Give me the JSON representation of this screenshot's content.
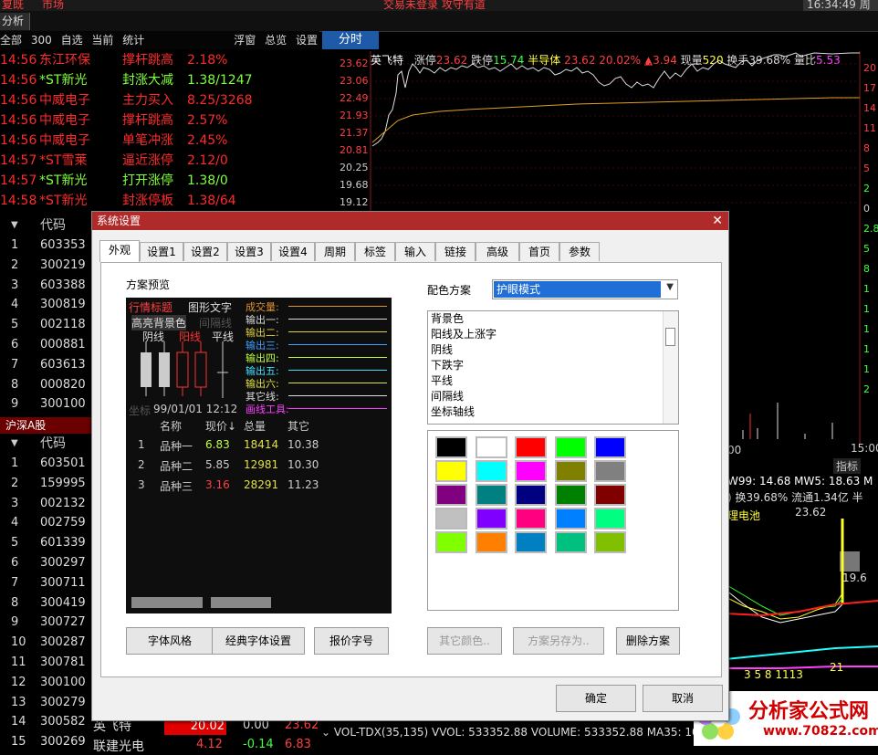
{
  "top": {
    "title_left_1": "复既",
    "title_left_2": "市场",
    "title_center": "交易未登录  攻守有道",
    "title_right": "16:34:49 周六"
  },
  "tabs": {
    "analysis": "分析"
  },
  "filters": {
    "items": [
      "全部",
      "300",
      "自选",
      "当前",
      "统计"
    ],
    "right": [
      "浮窗",
      "总览",
      "设置"
    ]
  },
  "timeshare_tab": "分时",
  "alerts": [
    {
      "time": "14:56",
      "name": "东江环保",
      "event": "撑杆跳高",
      "value": "2.18%",
      "color": "#ff2a2a"
    },
    {
      "time": "14:56",
      "name": "*ST新光",
      "event": "封涨大减",
      "value": "1.38/1247",
      "color": "#7fff3a"
    },
    {
      "time": "14:56",
      "name": "中威电子",
      "event": "主力买入",
      "value": "8.25/3268",
      "color": "#ff2a2a"
    },
    {
      "time": "14:56",
      "name": "中威电子",
      "event": "撑杆跳高",
      "value": "2.57%",
      "color": "#ff2a2a"
    },
    {
      "time": "14:56",
      "name": "中威电子",
      "event": "单笔冲涨",
      "value": "2.45%",
      "color": "#ff2a2a"
    },
    {
      "time": "14:57",
      "name": "*ST雪莱",
      "event": "逼近涨停",
      "value": "2.12/0",
      "color": "#ff2a2a"
    },
    {
      "time": "14:57",
      "name": "*ST新光",
      "event": "打开涨停",
      "value": "1.38/0",
      "color": "#7fff3a"
    },
    {
      "time": "14:58",
      "name": "*ST新光",
      "event": "封涨停板",
      "value": "1.38/64",
      "color": "#ff2a2a"
    }
  ],
  "table1": {
    "header": "代码",
    "rows": [
      {
        "idx": "1",
        "code": "603353"
      },
      {
        "idx": "2",
        "code": "300219"
      },
      {
        "idx": "3",
        "code": "603388"
      },
      {
        "idx": "4",
        "code": "300819"
      },
      {
        "idx": "5",
        "code": "002118"
      },
      {
        "idx": "6",
        "code": "000881"
      },
      {
        "idx": "7",
        "code": "603613"
      },
      {
        "idx": "8",
        "code": "000820"
      },
      {
        "idx": "9",
        "code": "300100"
      }
    ]
  },
  "section2": {
    "title": "沪深A股",
    "header": "代码"
  },
  "table2": {
    "rows": [
      {
        "idx": "1",
        "code": "603501"
      },
      {
        "idx": "2",
        "code": "159995"
      },
      {
        "idx": "3",
        "code": "002132"
      },
      {
        "idx": "4",
        "code": "002759"
      },
      {
        "idx": "5",
        "code": "601339"
      },
      {
        "idx": "6",
        "code": "300297"
      },
      {
        "idx": "7",
        "code": "300711"
      },
      {
        "idx": "8",
        "code": "300419"
      },
      {
        "idx": "9",
        "code": "300727"
      },
      {
        "idx": "10",
        "code": "300287"
      },
      {
        "idx": "11",
        "code": "300781"
      },
      {
        "idx": "12",
        "code": "300100"
      },
      {
        "idx": "13",
        "code": "300279"
      },
      {
        "idx": "14",
        "code": "300582"
      },
      {
        "idx": "15",
        "code": "300269"
      }
    ],
    "row14_name": "英飞特",
    "row14_pct": "20.02",
    "row14_chg": "0.00",
    "row14_price": "23.62",
    "row15_name": "联建光电",
    "row15_pct": "4.12",
    "row15_chg": "-0.14",
    "row15_price": "6.83"
  },
  "chart_header": {
    "name": "英飞特",
    "limit_up_label": "涨停",
    "limit_up": "23.62",
    "limit_down_label": "跌停",
    "limit_down": "15.74",
    "sector": "半导体",
    "price": "23.62",
    "pct": "20.02%",
    "chg": "▲3.94",
    "vol_label": "现量",
    "vol": "520",
    "turnover_label": "换手",
    "turnover": "39.68%",
    "ratio_label": "量比",
    "ratio": "5.53"
  },
  "y_axis": [
    "23.62",
    "23.06",
    "22.49",
    "21.93",
    "21.37",
    "20.81",
    "20.25",
    "19.68",
    "19.12"
  ],
  "right_axis": [
    "20",
    "17",
    "14",
    "11",
    "8",
    "5",
    "2",
    "0",
    "2.8",
    "5",
    "8",
    "1",
    "1",
    "1",
    "1",
    "1",
    "2"
  ],
  "time_end": "15:00",
  "time_mid": "00",
  "kline": {
    "indicator_label": "指标",
    "ma_line": "W99: 14.68  MW5: 18.63  M",
    "info_line": ") 换39.68% 流通1.34亿 半",
    "sector_name": "理电池",
    "high_label": "23.62",
    "side_label": "19.6",
    "low_nums": "3 5  8  1113",
    "low_label": "21"
  },
  "bottom_status": "VOL-TDX(35,135) VVOL: 533352.88 VOLUME: 533352.88 MA35: 108600",
  "watermark": {
    "text": "分析家公式网",
    "url": "www.70822.com"
  },
  "dialog": {
    "title": "系统设置",
    "tabs": [
      "外观",
      "设置1",
      "设置2",
      "设置3",
      "设置4",
      "周期",
      "标签",
      "输入",
      "链接",
      "高级",
      "首页",
      "参数"
    ],
    "preview_label": "方案预览",
    "scheme_label": "配色方案",
    "scheme_value": "护眼模式",
    "color_items": [
      "背景色",
      "阳线及上涨字",
      "阴线",
      "下跌字",
      "平线",
      "间隔线",
      "坐标轴线"
    ],
    "preview": {
      "quote_title": "行情标题",
      "graph_text": "图形文字",
      "hl_bg": "高亮背景色",
      "sep_line": "间隔线",
      "yin": "阴线",
      "yang": "阳线",
      "flat": "平线",
      "outputs": [
        "成交量:",
        "输出一:",
        "输出二:",
        "输出三:",
        "输出四:",
        "输出五:",
        "输出六:",
        "其它线:",
        "画线工具:"
      ],
      "coord_label": "坐标",
      "coord_value": "99/01/01 12:12",
      "cols": [
        "名称",
        "现价↓",
        "总量",
        "其它"
      ],
      "rows": [
        {
          "i": "1",
          "name": "品种一",
          "price": "6.83",
          "vol": "18414",
          "other": "10.38"
        },
        {
          "i": "2",
          "name": "品种二",
          "price": "5.85",
          "vol": "12981",
          "other": "10.30"
        },
        {
          "i": "3",
          "name": "品种三",
          "price": "3.16",
          "vol": "28291",
          "other": "11.23"
        }
      ]
    },
    "buttons": {
      "font_style": "字体风格",
      "classic_font": "经典字体设置",
      "quote_font": "报价字号",
      "other_color": "其它颜色..",
      "save_as": "方案另存为..",
      "delete": "删除方案",
      "ok": "确定",
      "cancel": "取消"
    },
    "palette": [
      "#000000",
      "#ffffff",
      "#ff0000",
      "#00ff00",
      "#0000ff",
      "#ffff00",
      "#00ffff",
      "#ff00ff",
      "#808000",
      "#808080",
      "#800080",
      "#008080",
      "#000080",
      "#008000",
      "#800000",
      "#c0c0c0",
      "#8000ff",
      "#ff0080",
      "#0080ff",
      "#00ff80",
      "#80ff00",
      "#ff8000",
      "#0080c0",
      "#00c080",
      "#80c000"
    ]
  }
}
